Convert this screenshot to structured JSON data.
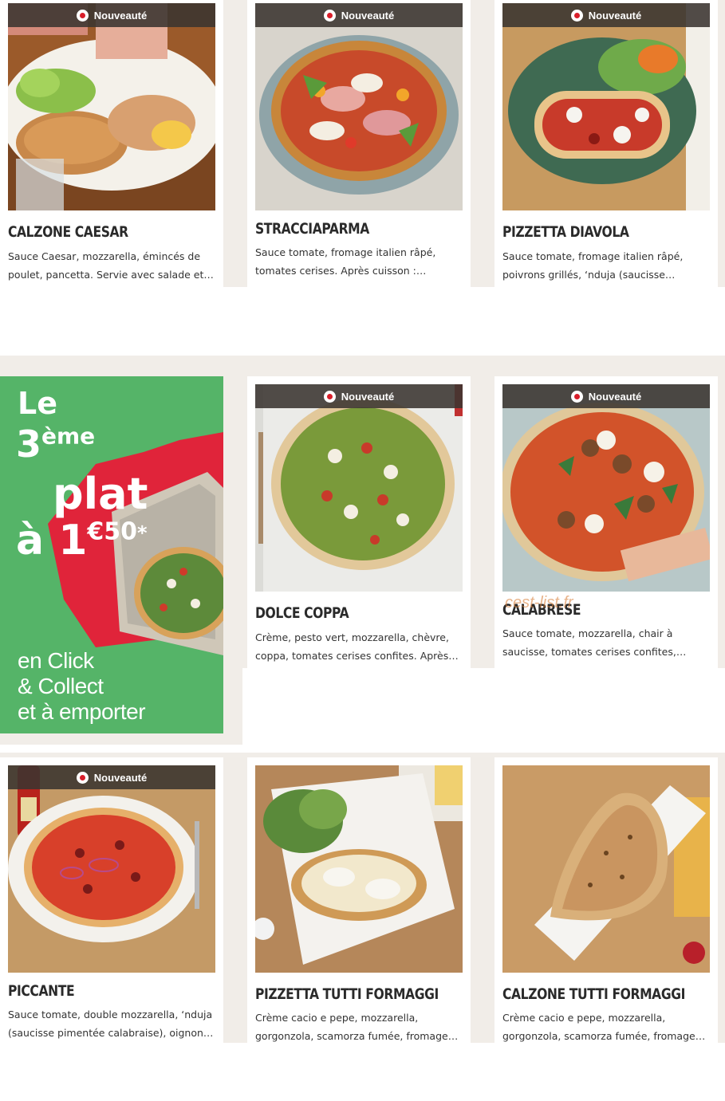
{
  "badge_label": "Nouveauté",
  "cards": [
    {
      "title": "CALZONE CAESAR",
      "description": "Sauce Caesar, mozzarella, émincés de poulet, pancetta. Servie avec salade et…",
      "badge": true
    },
    {
      "title": "STRACCIAPARMA",
      "description": "Sauce tomate, fromage italien râpé, tomates cerises. Après cuisson :…",
      "badge": true
    },
    {
      "title": "PIZZETTA DIAVOLA",
      "description": "Sauce tomate, fromage italien râpé, poivrons grillés, ‘nduja (saucisse…",
      "badge": true
    },
    {
      "title": "DOLCE COPPA",
      "description": "Crème, pesto vert, mozzarella, chèvre, coppa, tomates cerises confites. Après…",
      "badge": true
    },
    {
      "title": "CALABRESE",
      "description": "Sauce tomate, mozzarella, chair à saucisse, tomates cerises confites,…",
      "badge": true
    },
    {
      "title": "PICCANTE",
      "description": "Sauce tomate, double mozzarella, ‘nduja (saucisse pimentée calabraise), oignon…",
      "badge": true
    },
    {
      "title": "PIZZETTA TUTTI FORMAGGI",
      "description": "Crème cacio e pepe, mozzarella, gorgonzola, scamorza fumée, fromage…",
      "badge": false
    },
    {
      "title": "CALZONE TUTTI FORMAGGI",
      "description": "Crème cacio e pepe, mozzarella, gorgonzola, scamorza fumée, fromage…",
      "badge": false
    }
  ],
  "promo": {
    "le": "Le",
    "num": "3",
    "ordinal": "ème",
    "plat": "plat",
    "a": "à 1",
    "price_sup": "€50",
    "star": "*",
    "click": "en Click",
    "collect": "& Collect",
    "emporter": "et à emporter"
  },
  "watermark": "cest-list.fr",
  "colors": {
    "promo_green": "#55b468",
    "promo_red": "#e0243a",
    "badge_bg": "#3a3430",
    "band": "#f1ede8"
  }
}
